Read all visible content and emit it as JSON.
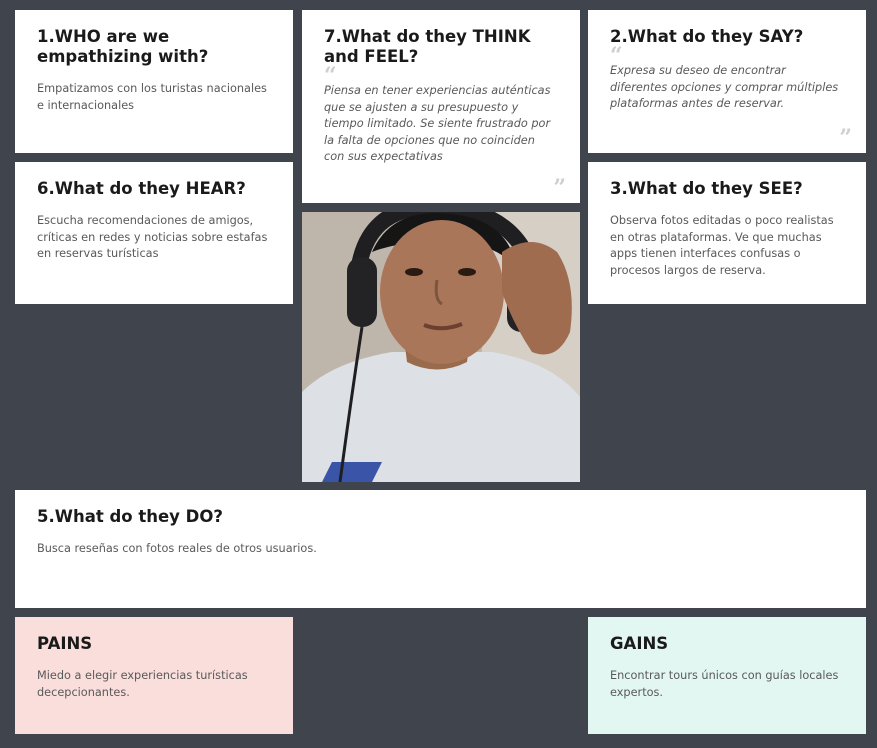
{
  "cards": {
    "who": {
      "title": "1.WHO are we empathizing with?",
      "text": "Empatizamos con los turistas nacionales e internacionales"
    },
    "think": {
      "title": "7.What do they THINK and FEEL?",
      "text": "Piensa en tener experiencias auténticas que se ajusten a su presupuesto y tiempo limitado. Se siente frustrado por la falta de opciones  que no coinciden con sus expectativas"
    },
    "say": {
      "title": "2.What do they SAY?",
      "text": "Expresa su deseo de encontrar diferentes opciones  y comprar múltiples plataformas antes de reservar."
    },
    "hear": {
      "title": "6.What do they HEAR?",
      "text": "Escucha recomendaciones de amigos, críticas en redes y noticias  sobre estafas en reservas turísticas"
    },
    "see": {
      "title": "3.What do they SEE?",
      "text": "Observa fotos editadas o poco  realistas en otras plataformas. Ve que muchas apps tienen interfaces  confusas o procesos largos de reserva."
    },
    "do": {
      "title": "5.What do they DO?",
      "text": "Busca reseñas con fotos reales de otros usuarios."
    },
    "pains": {
      "title": "PAINS",
      "text": "Miedo a elegir experiencias turísticas decepcionantes."
    },
    "gains": {
      "title": "GAINS",
      "text": "Encontrar tours únicos con guías locales expertos."
    }
  },
  "quote_marks": {
    "open": "“",
    "close": "”"
  },
  "colors": {
    "background": "#40454d",
    "card": "#ffffff",
    "pains": "#f9dedc",
    "gains": "#e3f7f2"
  }
}
